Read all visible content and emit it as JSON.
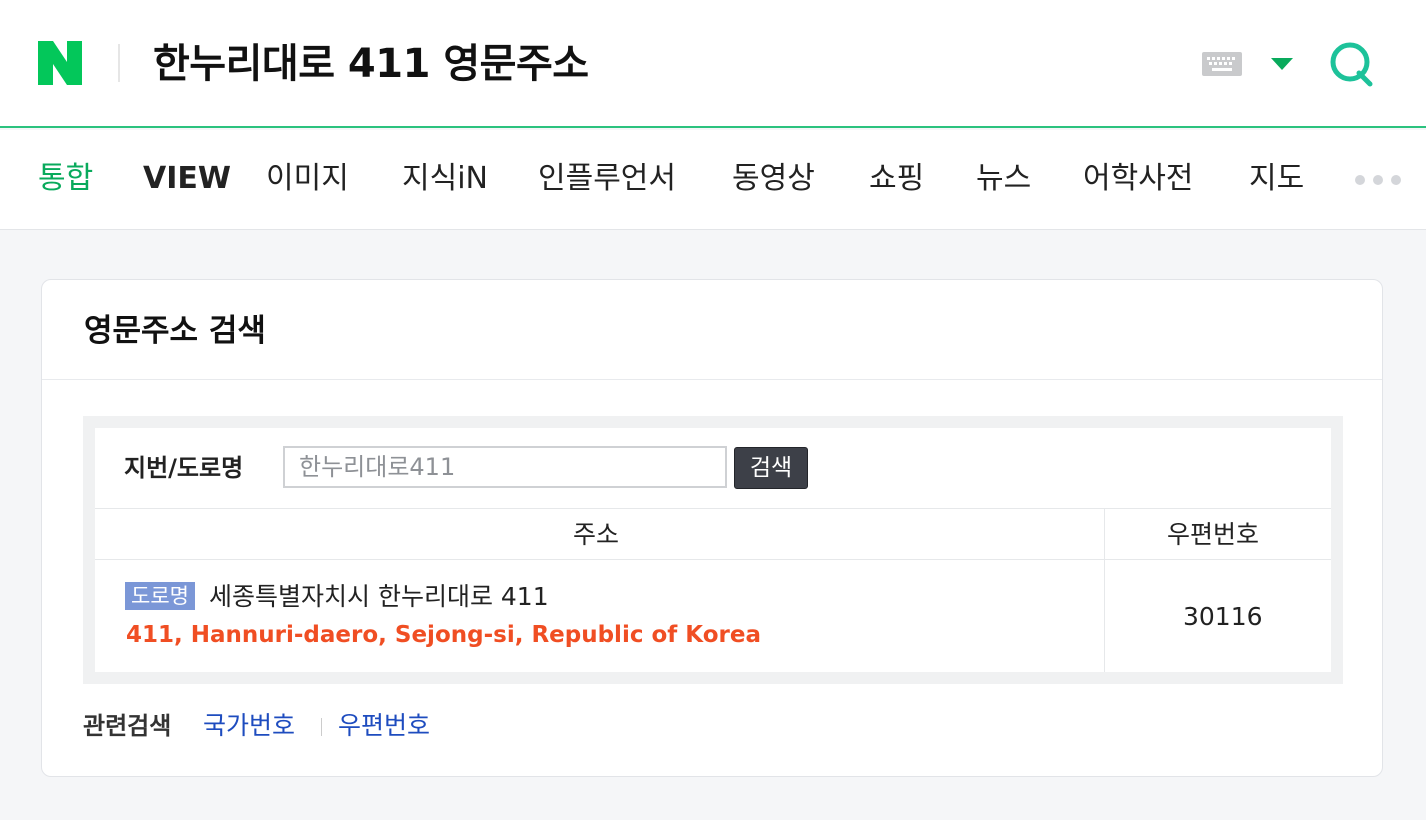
{
  "header": {
    "query": "한누리대로 411 영문주소",
    "logo_icon": "naver-n-logo",
    "brand_color": "#03c75a",
    "accent_color": "#2bc27e"
  },
  "tabs": [
    {
      "label": "통합",
      "active": true
    },
    {
      "label": "VIEW"
    },
    {
      "label": "이미지"
    },
    {
      "label": "지식iN"
    },
    {
      "label": "인플루언서"
    },
    {
      "label": "동영상"
    },
    {
      "label": "쇼핑"
    },
    {
      "label": "뉴스"
    },
    {
      "label": "어학사전"
    },
    {
      "label": "지도"
    }
  ],
  "card": {
    "title": "영문주소 검색",
    "search": {
      "label": "지번/도로명",
      "placeholder": "한누리대로411",
      "button_label": "검색"
    },
    "table": {
      "headers": [
        "주소",
        "우편번호"
      ],
      "rows": [
        {
          "badge": "도로명",
          "korean": "세종특별자치시 한누리대로 411",
          "english": "411, Hannuri-daero, Sejong-si, Republic of Korea",
          "zip": "30116"
        }
      ]
    },
    "related": {
      "label": "관련검색",
      "links": [
        "국가번호",
        "우편번호"
      ]
    }
  },
  "colors": {
    "active_tab": "#09aa5c",
    "english_address": "#f04e23",
    "link": "#1e4cbf",
    "badge": "#7b97d7"
  }
}
